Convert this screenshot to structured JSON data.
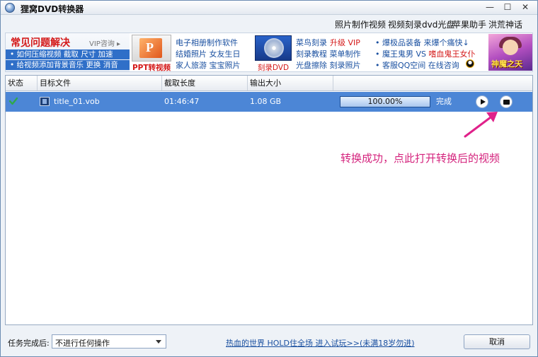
{
  "window": {
    "title": "狸窝DVD转换器"
  },
  "window_buttons": {
    "minimize": "—",
    "maximize": "☐",
    "close": "✕"
  },
  "topnav": [
    "照片制作视频",
    "视频刻录dvd光盘",
    "苹果助手",
    "洪荒神话"
  ],
  "banner": {
    "faq_title": "常见问题解决",
    "faq_vip": "VIP咨询 ▸",
    "faq_line1": "• 如何压缩视频 截取 尺寸 加速",
    "faq_line2": "• 给视频添加背景音乐 更换 消音",
    "ppt_caption": "PPT转视频",
    "col2": [
      "电子相册制作软件",
      "结婚照片 女友生日",
      "家人旅游 宝宝照片"
    ],
    "dvd_caption": "刻录DVD",
    "col3_a": [
      "菜鸟刻录",
      "刻录教程 菜单制作",
      "光盘擦除 刻录照片"
    ],
    "col3_upgrade": "升级 VIP",
    "col4_a": "• 爆极品装备 来爆个痛快↓",
    "col4_b1": "• 魔王鬼男",
    "col4_b2": " VS ",
    "col4_b3": "嗜血鬼王女仆",
    "col4_c": "• 客服QQ空间 在线咨询",
    "game_logo": "神魔之天"
  },
  "grid": {
    "columns": [
      "状态",
      "目标文件",
      "截取长度",
      "输出大小"
    ],
    "rows": [
      {
        "file": "title_01.vob",
        "length": "01:46:47",
        "size": "1.08 GB",
        "progress_text": "100.00%",
        "progress": 1.0,
        "status": "完成"
      }
    ]
  },
  "hint": "转换成功，点此打开转换后的视频",
  "footer": {
    "label": "任务完成后:",
    "select_value": "不进行任何操作",
    "ad_link": "热血的世界 HOLD住全场 进入试玩>>(未满18岁勿进)",
    "cancel": "取消"
  },
  "colors": {
    "accent": "#4c86d6",
    "hint": "#d4237d",
    "link": "#1a50a0",
    "red": "#d41818"
  }
}
